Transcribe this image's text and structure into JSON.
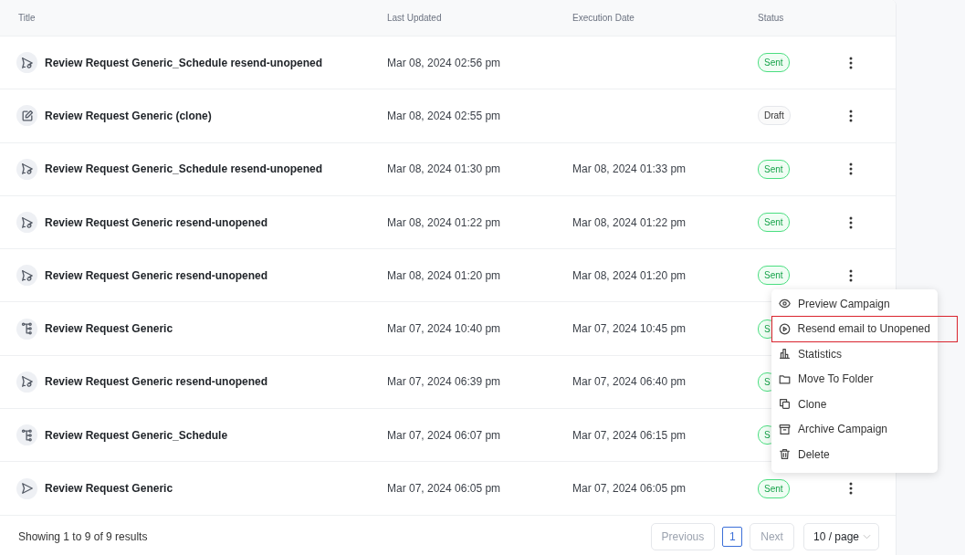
{
  "table": {
    "columns": [
      "Title",
      "Last Updated",
      "Execution Date",
      "Status"
    ],
    "rows": [
      {
        "kind": "resend",
        "title": "Review Request Generic_Schedule resend-unopened",
        "last_updated": "Mar 08, 2024 02:56 pm",
        "status": {
          "kind": "sent",
          "text": "Sent"
        },
        "more_button": true
      },
      {
        "kind": "edit",
        "title": "Review Request Generic (clone)",
        "last_updated": "Mar 08, 2024 02:55 pm",
        "status": {
          "kind": "draft",
          "text": "Draft"
        },
        "more_button": true
      },
      {
        "kind": "resend",
        "title": "Review Request Generic_Schedule resend-unopened",
        "last_updated": "Mar 08, 2024 01:30 pm",
        "execution_date": "Mar 08, 2024 01:33 pm",
        "status": {
          "kind": "sent",
          "text": "Sent"
        },
        "more_button": true
      },
      {
        "kind": "resend",
        "title": "Review Request Generic resend-unopened",
        "last_updated": "Mar 08, 2024 01:22 pm",
        "execution_date": "Mar 08, 2024 01:22 pm",
        "status": {
          "kind": "sent",
          "text": "Sent"
        },
        "more_button": true
      },
      {
        "kind": "resend",
        "title": "Review Request Generic resend-unopened",
        "last_updated": "Mar 08, 2024 01:20 pm",
        "execution_date": "Mar 08, 2024 01:20 pm",
        "status": {
          "kind": "sent",
          "text": "Sent"
        },
        "more_button": true
      },
      {
        "kind": "flow",
        "title": "Review Request Generic",
        "last_updated": "Mar 07, 2024 10:40 pm",
        "execution_date": "Mar 07, 2024 10:45 pm",
        "status": {
          "kind": "sent",
          "text": "S"
        },
        "more_button": false
      },
      {
        "kind": "resend",
        "title": "Review Request Generic resend-unopened",
        "last_updated": "Mar 07, 2024 06:39 pm",
        "execution_date": "Mar 07, 2024 06:40 pm",
        "status": {
          "kind": "sent",
          "text": "S"
        },
        "more_button": false
      },
      {
        "kind": "flow",
        "title": "Review Request Generic_Schedule",
        "last_updated": "Mar 07, 2024 06:07 pm",
        "execution_date": "Mar 07, 2024 06:15 pm",
        "status": {
          "kind": "sent",
          "text": "S"
        },
        "more_button": false
      },
      {
        "kind": "send",
        "title": "Review Request Generic",
        "last_updated": "Mar 07, 2024 06:05 pm",
        "execution_date": "Mar 07, 2024 06:05 pm",
        "status": {
          "kind": "sent",
          "text": "Sent"
        },
        "more_button": true
      }
    ]
  },
  "context_menu": {
    "items": [
      {
        "kind": "eye",
        "label": "Preview Campaign",
        "highlighted": false
      },
      {
        "kind": "play",
        "label": "Resend email to Unopened",
        "highlighted": true
      },
      {
        "kind": "chart",
        "label": "Statistics",
        "highlighted": false
      },
      {
        "kind": "folder",
        "label": "Move To Folder",
        "highlighted": false
      },
      {
        "kind": "copy",
        "label": "Clone",
        "highlighted": false
      },
      {
        "kind": "archive",
        "label": "Archive Campaign",
        "highlighted": false
      },
      {
        "kind": "trash",
        "label": "Delete",
        "highlighted": false
      }
    ]
  },
  "footer": {
    "summary": "Showing 1 to 9 of 9 results",
    "pagination": {
      "previous": {
        "label": "Previous",
        "disabled": true
      },
      "pages": [
        {
          "label": "1",
          "selected": true
        }
      ],
      "next": {
        "label": "Next",
        "disabled": true
      },
      "page_size": "10 / page"
    }
  }
}
